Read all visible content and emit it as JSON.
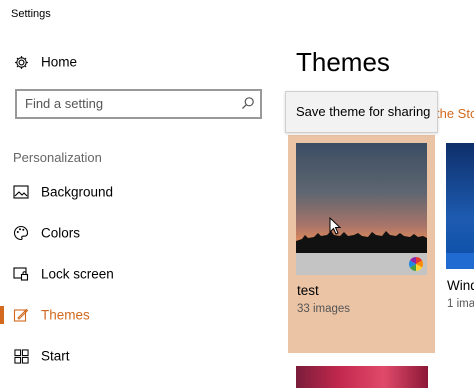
{
  "window": {
    "title": "Settings"
  },
  "sidebar": {
    "home_label": "Home",
    "search_placeholder": "Find a setting",
    "section_header": "Personalization",
    "items": [
      {
        "label": "Background",
        "icon": "image-icon"
      },
      {
        "label": "Colors",
        "icon": "palette-icon"
      },
      {
        "label": "Lock screen",
        "icon": "lock-screen-icon"
      },
      {
        "label": "Themes",
        "icon": "themes-brush-icon",
        "active": true
      },
      {
        "label": "Start",
        "icon": "start-grid-icon"
      }
    ]
  },
  "main": {
    "title": "Themes",
    "store_link": "the Sto",
    "tooltip": "Save theme for sharing",
    "themes": [
      {
        "name": "test",
        "count": "33 images",
        "selected": true
      },
      {
        "name": "Wind",
        "count": "1 ima"
      }
    ]
  },
  "colors": {
    "accent": "#d2691e",
    "selected_card": "#ebc4a6"
  }
}
